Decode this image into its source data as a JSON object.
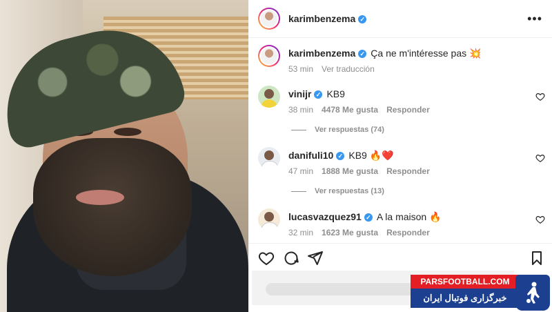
{
  "post": {
    "author": "karimbenzema",
    "verified_glyph": "✓",
    "more_glyph": "•••"
  },
  "caption": {
    "username": "karimbenzema",
    "text": "Ça ne m'intéresse pas 💥",
    "time": "53 min",
    "translate": "Ver traducción"
  },
  "comments": [
    {
      "username": "vinijr",
      "text": "KB9",
      "time": "38 min",
      "likes": "4478 Me gusta",
      "reply": "Responder",
      "replies": "Ver respuestas (74)"
    },
    {
      "username": "danifuli10",
      "text": "KB9 🔥❤️",
      "time": "47 min",
      "likes": "1888 Me gusta",
      "reply": "Responder",
      "replies": "Ver respuestas (13)"
    },
    {
      "username": "lucasvazquez91",
      "text": "A la maison 🔥",
      "time": "32 min",
      "likes": "1623 Me gusta",
      "reply": "Responder"
    }
  ],
  "actions": {
    "like_icon": "heart-icon",
    "comment_icon": "comment-icon",
    "share_icon": "send-icon",
    "save_icon": "bookmark-icon"
  },
  "watermark": {
    "line1": "PARSFOOTBALL.COM",
    "line2": "خبرگزاری فوتبال ایران"
  },
  "colors": {
    "verified": "#3897f0",
    "brand_red": "#e31e24",
    "brand_blue": "#1c3f8f"
  }
}
